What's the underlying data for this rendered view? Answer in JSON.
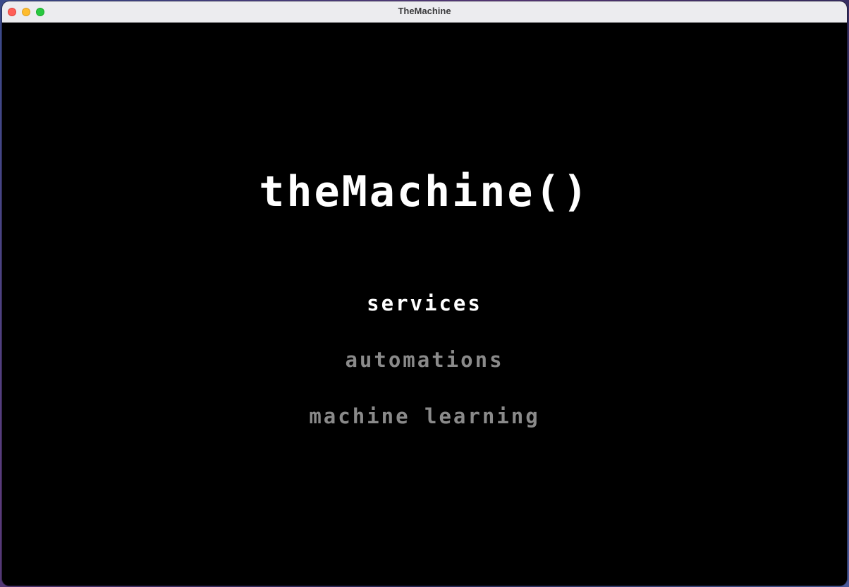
{
  "window": {
    "title": "TheMachine"
  },
  "main": {
    "logo_text": "theMachine()",
    "menu": [
      {
        "label": "services",
        "state": "selected"
      },
      {
        "label": "automations",
        "state": "normal"
      },
      {
        "label": "machine learning",
        "state": "normal"
      }
    ]
  },
  "colors": {
    "background": "#000000",
    "selected_text": "#ffffff",
    "normal_text": "#8a8a8a"
  }
}
